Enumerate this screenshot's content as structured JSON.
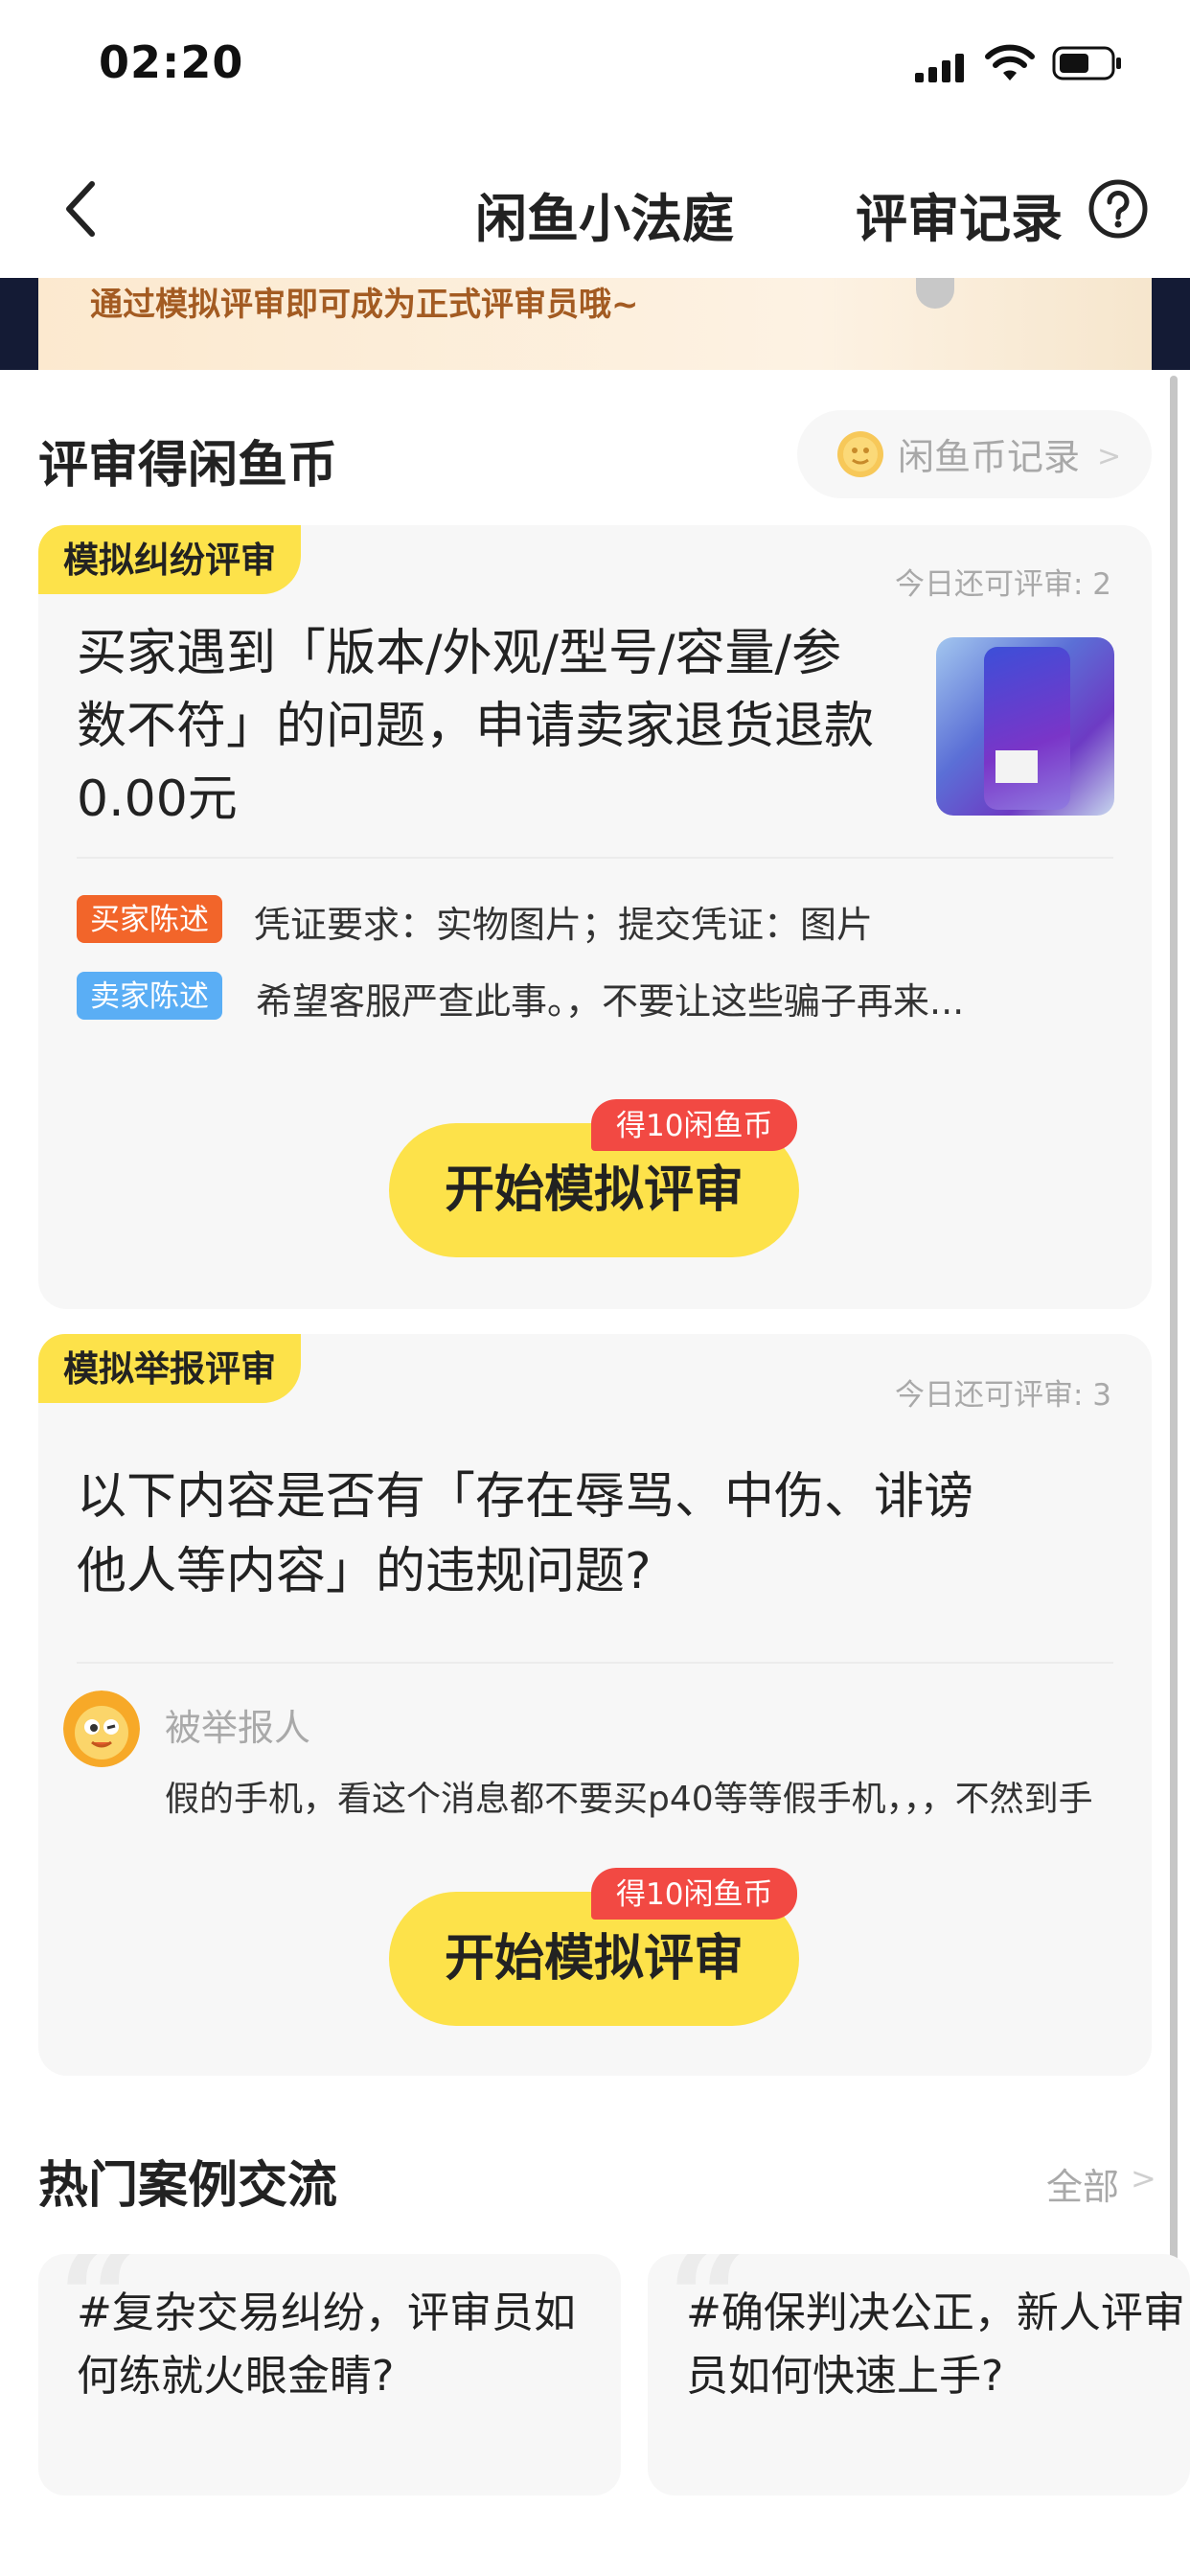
{
  "status": {
    "time": "02:20"
  },
  "nav": {
    "title": "闲鱼小法庭",
    "records": "评审记录"
  },
  "banner": {
    "text": "通过模拟评审即可成为正式评审员哦~"
  },
  "section": {
    "title": "评审得闲鱼币",
    "coin_record": "闲鱼币记录"
  },
  "card1": {
    "tag": "模拟纠纷评审",
    "remaining": "今日还可评审: 2",
    "question": [
      "买家遇到「版本/外观/型号/容量/参",
      "数不符」的问题，申请卖家退货退款",
      "0.00元"
    ],
    "buyer_tag": "买家陈述",
    "buyer_text": "凭证要求：实物图片；提交凭证：图片",
    "seller_tag": "卖家陈述",
    "seller_text": "希望客服严查此事。，不要让这些骗子再来...",
    "reward": "得10闲鱼币",
    "button": "开始模拟评审"
  },
  "card2": {
    "tag": "模拟举报评审",
    "remaining": "今日还可评审: 3",
    "question": [
      "以下内容是否有「存在辱骂、中伤、诽谤",
      "他人等内容」的违规问题?"
    ],
    "reported_label": "被举报人",
    "reported_text": "假的手机，看这个消息都不要买p40等等假手机，，，不然到手",
    "reward": "得10闲鱼币",
    "button": "开始模拟评审"
  },
  "hot": {
    "title": "热门案例交流",
    "all": "全部",
    "cases": [
      {
        "lines": [
          "#复杂交易纠纷，评审员如",
          "何练就火眼金睛?"
        ]
      },
      {
        "lines": [
          "#确保判决公正，新人评审",
          "员如何快速上手?"
        ]
      }
    ]
  },
  "colors": {
    "accent_yellow": "#fde24a",
    "badge_red": "#f24943",
    "buyer_orange": "#f2652a",
    "seller_blue": "#5aaef5",
    "banner_brown": "#a35b22"
  }
}
